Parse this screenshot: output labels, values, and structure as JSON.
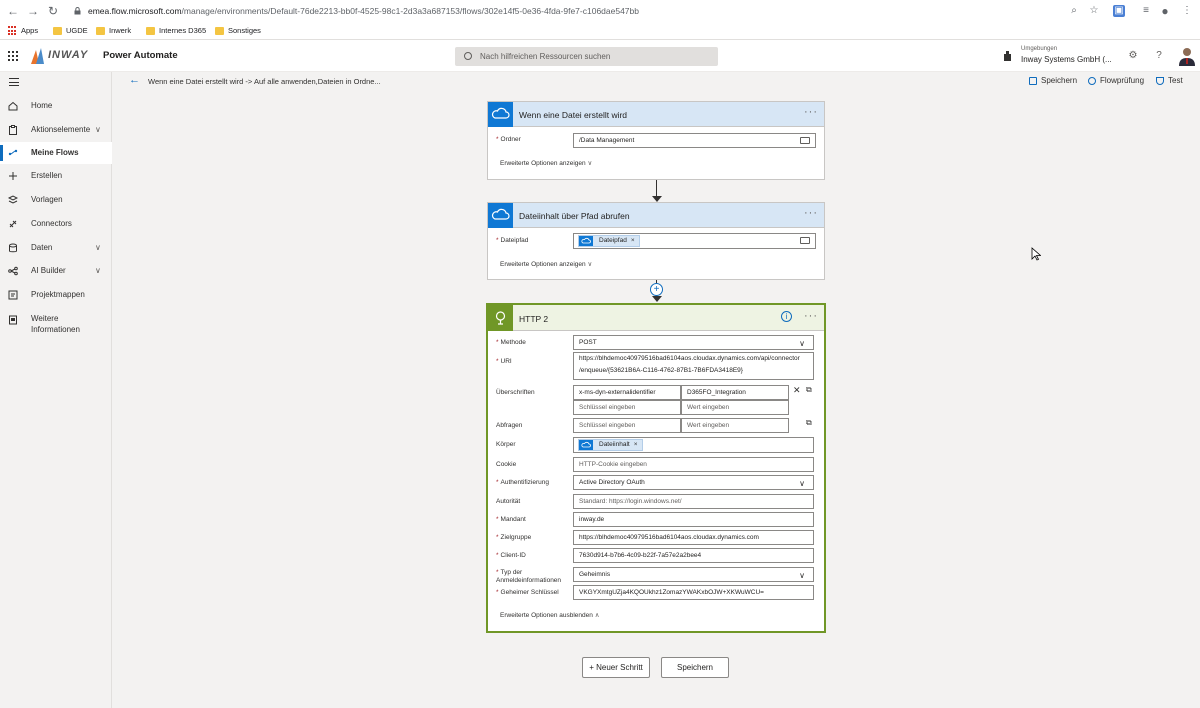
{
  "browser": {
    "url_host": "emea.flow.microsoft.com",
    "url_path": "/manage/environments/Default-76de2213-bb0f-4525-98c1-2d3a3a687153/flows/302e14f5-0e36-4fda-9fe7-c106dae547bb",
    "bookmarks": [
      "Apps",
      "UGDE",
      "Inwerk",
      "Internes D365",
      "Sonstiges"
    ]
  },
  "header": {
    "logo_text": "INWAY",
    "app_name": "Power Automate",
    "search_placeholder": "Nach hilfreichen Ressourcen suchen",
    "env_label": "Umgebungen",
    "env_name": "Inway Systems GmbH (..."
  },
  "sidebar": {
    "items": [
      {
        "label": "Home",
        "icon": "home-icon"
      },
      {
        "label": "Aktionselemente",
        "icon": "clipboard-icon",
        "expandable": true
      },
      {
        "label": "Meine Flows",
        "icon": "flow-icon",
        "active": true
      },
      {
        "label": "Erstellen",
        "icon": "plus-icon"
      },
      {
        "label": "Vorlagen",
        "icon": "template-icon"
      },
      {
        "label": "Connectors",
        "icon": "connector-icon"
      },
      {
        "label": "Daten",
        "icon": "database-icon",
        "expandable": true
      },
      {
        "label": "AI Builder",
        "icon": "ai-builder-icon",
        "expandable": true
      },
      {
        "label": "Projektmappen",
        "icon": "solutions-icon"
      },
      {
        "label": "Weitere Informationen",
        "icon": "book-icon"
      }
    ]
  },
  "commandbar": {
    "breadcrumb": "Wenn eine Datei erstellt wird -> Auf alle anwenden,Dateien in Ordne...",
    "save": "Speichern",
    "flow_checker": "Flowprüfung",
    "test": "Test"
  },
  "trigger": {
    "title": "Wenn eine Datei erstellt wird",
    "folder_label": "Ordner",
    "folder_value": "/Data Management",
    "advanced": "Erweiterte Optionen anzeigen"
  },
  "get_content": {
    "title": "Dateiinhalt über Pfad abrufen",
    "path_label": "Dateipfad",
    "path_token": "Dateipfad",
    "advanced": "Erweiterte Optionen anzeigen"
  },
  "http": {
    "title": "HTTP 2",
    "method_label": "Methode",
    "method_value": "POST",
    "uri_label": "URI",
    "uri_line1": "https://blhdemoc40979516bad6104aos.cloudax.dynamics.com/api/connector",
    "uri_line2": "/enqueue/{53621B6A-C116-4762-87B1-7B6FDA3418E9}",
    "headers_label": "Überschriften",
    "header_key": "x-ms-dyn-externalidentifier",
    "header_value": "D365FO_Integration",
    "key_placeholder": "Schlüssel eingeben",
    "value_placeholder": "Wert eingeben",
    "queries_label": "Abfragen",
    "body_label": "Körper",
    "body_token": "Dateiinhalt",
    "cookie_label": "Cookie",
    "cookie_placeholder": "HTTP-Cookie eingeben",
    "auth_label": "Authentifizierung",
    "auth_value": "Active Directory OAuth",
    "authority_label": "Autorität",
    "authority_placeholder": "Standard: https://login.windows.net/",
    "tenant_label": "Mandant",
    "tenant_value": "inway.de",
    "audience_label": "Zielgruppe",
    "audience_value": "https://blhdemoc40979516bad6104aos.cloudax.dynamics.com",
    "client_label": "Client-ID",
    "client_value": "7630d914-b7b6-4c09-b22f-7a57e2a2bee4",
    "credtype_label": "Typ der Anmeldeinformationen",
    "credtype_value": "Geheimnis",
    "secret_label": "Geheimer Schlüssel",
    "secret_value": "VKGYXmtgUZja4KQOUkhz1ZomazYWAKxbOJW+XKWuWCU=",
    "advanced_hide": "Erweiterte Optionen ausblenden"
  },
  "footer": {
    "new_step": "+ Neuer Schritt",
    "save": "Speichern"
  },
  "colors": {
    "accent": "#0f6cbd",
    "http_green": "#709727",
    "required": "#a4262c"
  }
}
